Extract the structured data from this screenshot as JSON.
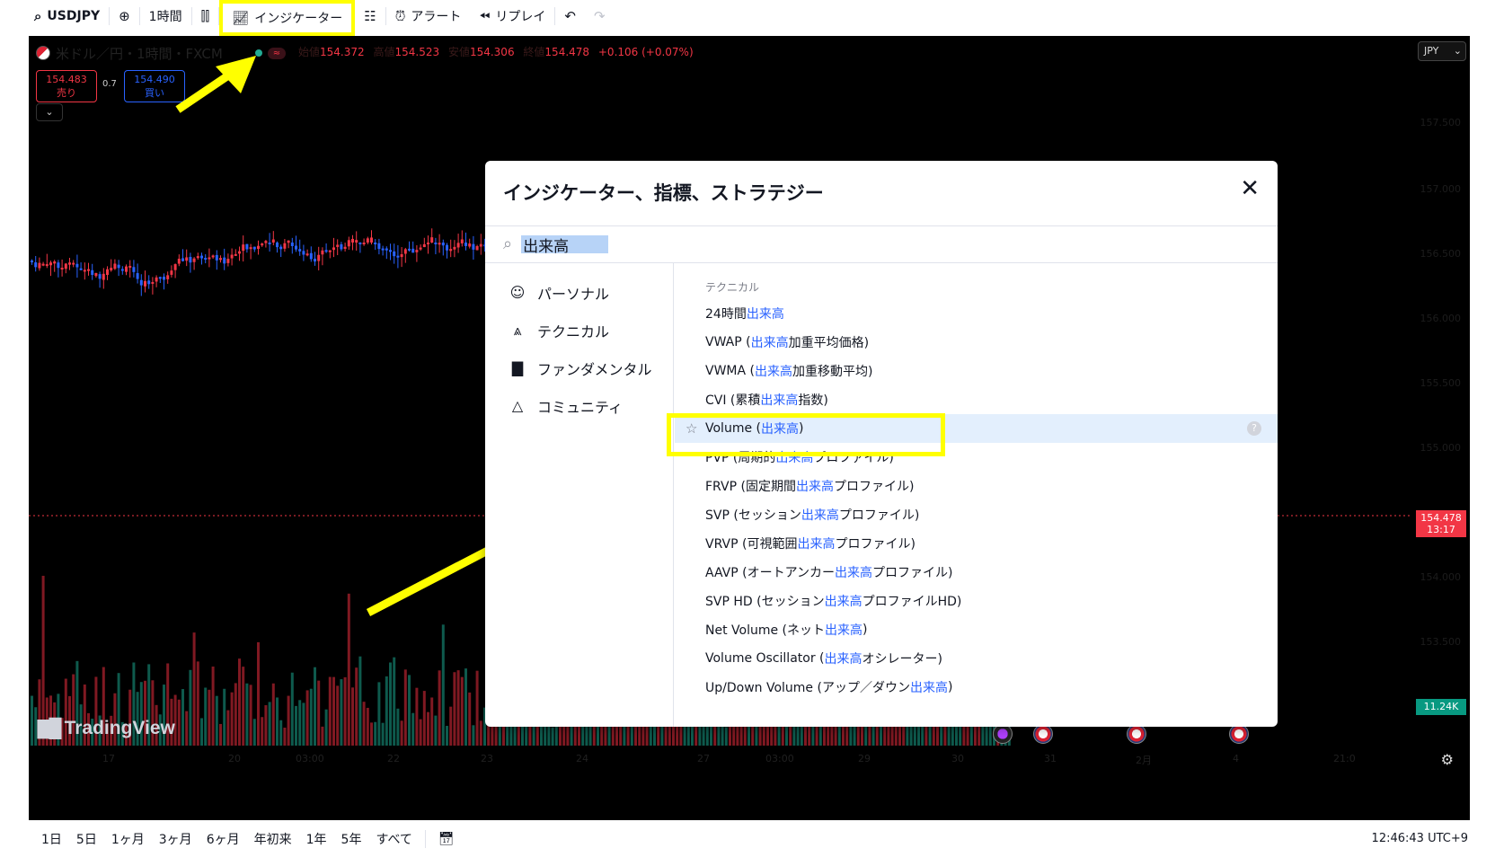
{
  "toolbar": {
    "symbol": "USDJPY",
    "interval": "1時間",
    "indicators_label": "インジケーター",
    "alert_label": "アラート",
    "replay_label": "リプレイ"
  },
  "chart": {
    "title": "米ドル／円・1時間・FXCM",
    "ohlc": {
      "open_label": "始値",
      "open": "154.372",
      "high_label": "高値",
      "high": "154.523",
      "low_label": "安値",
      "low": "154.306",
      "close_label": "終値",
      "close": "154.478",
      "change": "+0.106 (+0.07%)"
    },
    "sell_price": "154.483",
    "sell_label": "売り",
    "buy_price": "154.490",
    "buy_label": "買い",
    "spread": "0.7",
    "currency": "JPY",
    "price_axis": [
      "157.500",
      "157.000",
      "156.500",
      "156.000",
      "155.500",
      "155.000",
      "154.000",
      "153.500"
    ],
    "last_price": "154.478",
    "last_price_timer": "13:17",
    "volume_value": "11.24K",
    "time_axis": [
      "17",
      "20",
      "03:00",
      "22",
      "23",
      "24",
      "27",
      "03:00",
      "29",
      "30",
      "31",
      "2月",
      "4",
      "21:0"
    ],
    "logo_text": "TradingView",
    "colors": {
      "up": "#f23645",
      "down": "#2962ff",
      "vol_up": "#801922",
      "vol_down": "#0e5a4d",
      "annotation": "#ffff00"
    }
  },
  "modal": {
    "title": "インジケーター、指標、ストラテジー",
    "search_value": "出来高",
    "sidebar": [
      {
        "label": "パーソナル",
        "icon": "user-icon"
      },
      {
        "label": "テクニカル",
        "icon": "chart-icon"
      },
      {
        "label": "ファンダメンタル",
        "icon": "bar-chart-icon"
      },
      {
        "label": "コミュニティ",
        "icon": "community-icon"
      }
    ],
    "section": "テクニカル",
    "results": [
      {
        "pre": "24時間",
        "hit": "出来高",
        "post": ""
      },
      {
        "pre": "VWAP (",
        "hit": "出来高",
        "post": "加重平均価格)"
      },
      {
        "pre": "VWMA (",
        "hit": "出来高",
        "post": "加重移動平均)"
      },
      {
        "pre": "CVI (累積",
        "hit": "出来高",
        "post": "指数)"
      },
      {
        "pre": "Volume (",
        "hit": "出来高",
        "post": ")"
      },
      {
        "pre": "PVP (周期的",
        "hit": "出来高",
        "post": "プロファイル)"
      },
      {
        "pre": "FRVP (固定期間",
        "hit": "出来高",
        "post": "プロファイル)"
      },
      {
        "pre": "SVP (セッション",
        "hit": "出来高",
        "post": "プロファイル)"
      },
      {
        "pre": "VRVP (可視範囲",
        "hit": "出来高",
        "post": "プロファイル)"
      },
      {
        "pre": "AAVP (オートアンカー",
        "hit": "出来高",
        "post": "プロファイル)"
      },
      {
        "pre": "SVP HD (セッション",
        "hit": "出来高",
        "post": "プロファイルHD)"
      },
      {
        "pre": "Net Volume (ネット",
        "hit": "出来高",
        "post": ")"
      },
      {
        "pre": "Volume Oscillator (",
        "hit": "出来高",
        "post": "オシレーター)"
      },
      {
        "pre": "Up/Down Volume (アップ／ダウン",
        "hit": "出来高",
        "post": ")"
      }
    ]
  },
  "bottombar": {
    "ranges": [
      "1日",
      "5日",
      "1ヶ月",
      "3ヶ月",
      "6ヶ月",
      "年初来",
      "1年",
      "5年",
      "すべて"
    ],
    "clock": "12:46:43 UTC+9"
  }
}
